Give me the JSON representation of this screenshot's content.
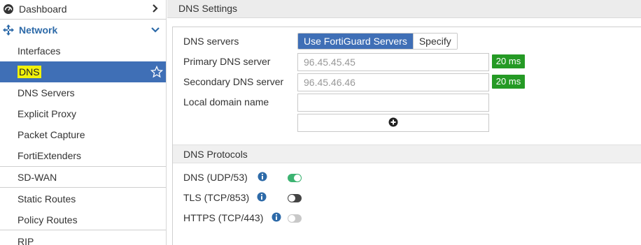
{
  "sidebar": {
    "dashboard": "Dashboard",
    "network": "Network",
    "items": [
      "Interfaces",
      "DNS",
      "DNS Servers",
      "Explicit Proxy",
      "Packet Capture",
      "FortiExtenders"
    ],
    "after_divider": [
      "SD-WAN",
      "Static Routes",
      "Policy Routes",
      "RIP"
    ]
  },
  "header": {
    "title": "DNS Settings"
  },
  "dns": {
    "servers_label": "DNS servers",
    "use_fortiguard": "Use FortiGuard Servers",
    "specify": "Specify",
    "primary_label": "Primary DNS server",
    "primary_value": "96.45.45.45",
    "primary_latency": "20 ms",
    "secondary_label": "Secondary DNS server",
    "secondary_value": "96.45.46.46",
    "secondary_latency": "20 ms",
    "local_domain_label": "Local domain name",
    "local_domain_value": ""
  },
  "protocols": {
    "title": "DNS Protocols",
    "items": [
      {
        "label": "DNS (UDP/53)",
        "enabled": true
      },
      {
        "label": "TLS (TCP/853)",
        "enabled": false
      },
      {
        "label": "HTTPS (TCP/443)",
        "enabled": false
      }
    ]
  },
  "colors": {
    "accent": "#3f6fb6",
    "badge_green": "#259a25",
    "toggle_on": "#3cb371",
    "highlight": "#f2f20a"
  },
  "icons": [
    "dashboard-icon",
    "network-icon",
    "chevron-right-icon",
    "chevron-down-icon",
    "star-icon",
    "plus-circle-icon",
    "info-icon"
  ]
}
